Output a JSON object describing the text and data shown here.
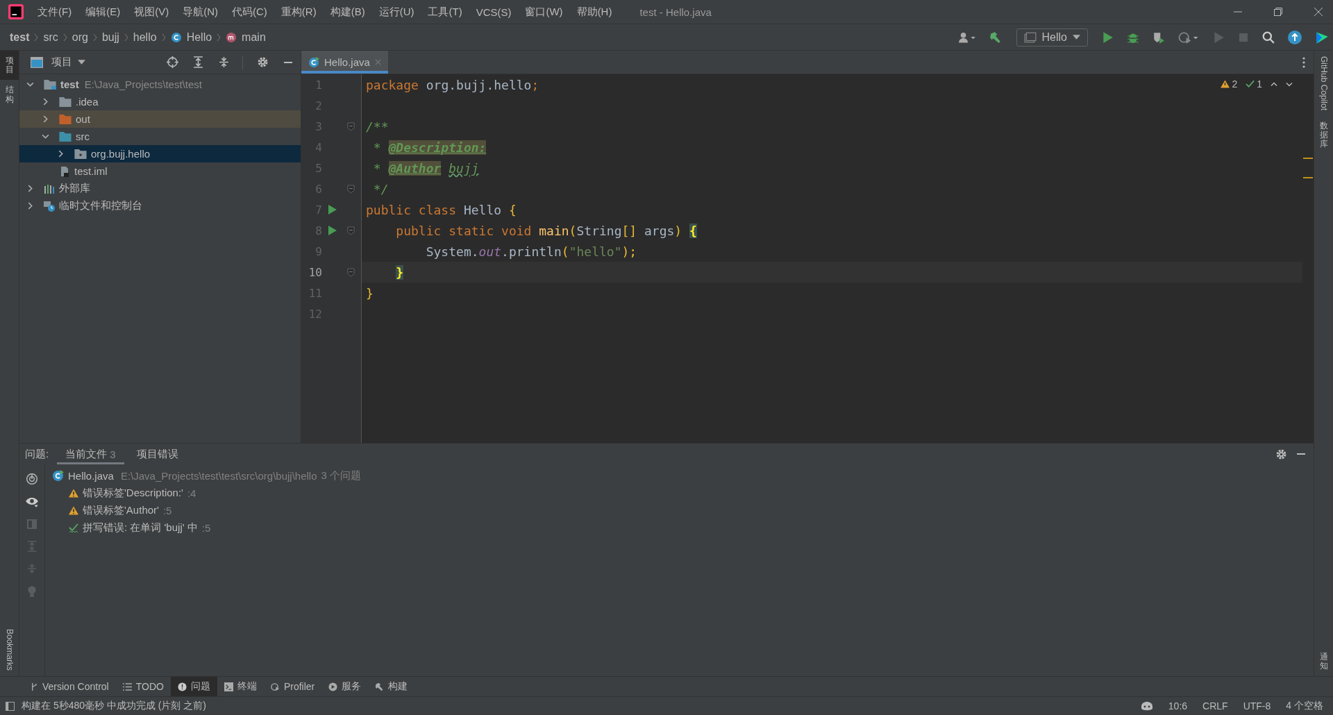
{
  "window": {
    "title": "test - Hello.java"
  },
  "menu": [
    "文件(F)",
    "编辑(E)",
    "视图(V)",
    "导航(N)",
    "代码(C)",
    "重构(R)",
    "构建(B)",
    "运行(U)",
    "工具(T)",
    "VCS(S)",
    "窗口(W)",
    "帮助(H)"
  ],
  "breadcrumbs": [
    {
      "label": "test",
      "kind": "project"
    },
    {
      "label": "src",
      "kind": "dir"
    },
    {
      "label": "org",
      "kind": "dir"
    },
    {
      "label": "bujj",
      "kind": "dir"
    },
    {
      "label": "hello",
      "kind": "dir"
    },
    {
      "label": "Hello",
      "kind": "class"
    },
    {
      "label": "main",
      "kind": "method"
    }
  ],
  "run_config": "Hello",
  "left_strip": [
    {
      "label": "项目",
      "selected": true
    },
    {
      "label": "结构",
      "selected": false
    }
  ],
  "left_strip_bottom": "Bookmarks",
  "right_strip": [
    {
      "label": "GitHub Copilot",
      "kind": "latin"
    },
    {
      "label": "数据库",
      "kind": "cjk"
    }
  ],
  "right_strip_bottom": "通知",
  "project": {
    "title": "项目",
    "tree": [
      {
        "label": "test",
        "path": "E:\\Java_Projects\\test\\test",
        "kind": "module",
        "expanded": true,
        "selected": false,
        "children": [
          {
            "label": ".idea",
            "kind": "folder",
            "expanded": false,
            "selected": false
          },
          {
            "label": "out",
            "kind": "excluded",
            "expanded": false,
            "selected": false
          },
          {
            "label": "src",
            "kind": "source",
            "expanded": true,
            "selected": false,
            "children": [
              {
                "label": "org.bujj.hello",
                "kind": "package",
                "expanded": false,
                "selected": true
              }
            ]
          },
          {
            "label": "test.iml",
            "kind": "file",
            "selected": false
          }
        ]
      },
      {
        "label": "外部库",
        "kind": "library",
        "expanded": false,
        "selected": false
      },
      {
        "label": "临时文件和控制台",
        "kind": "scratch",
        "expanded": false,
        "selected": false
      }
    ]
  },
  "editor": {
    "tabs": [
      {
        "label": "Hello.java",
        "selected": true
      }
    ],
    "warnings": "2",
    "typos": "1",
    "lines": [
      {
        "n": "1",
        "current": false,
        "tokens": [
          {
            "t": "package ",
            "kind": "kw"
          },
          {
            "t": "org.bujj.hello",
            "kind": "plain"
          },
          {
            "t": ";",
            "kind": "kw"
          }
        ]
      },
      {
        "n": "2",
        "current": false
      },
      {
        "n": "3",
        "current": false,
        "fold": true,
        "tokens": [
          {
            "t": "/**",
            "kind": "doc"
          }
        ]
      },
      {
        "n": "4",
        "current": false,
        "tokens": [
          {
            "t": " * ",
            "kind": "doc"
          },
          {
            "t": "@Description:",
            "kind": "tag"
          }
        ]
      },
      {
        "n": "5",
        "current": false,
        "tokens": [
          {
            "t": " * ",
            "kind": "doc"
          },
          {
            "t": "@Author",
            "kind": "tag"
          },
          {
            "t": "bujj",
            "kind": "typo"
          }
        ]
      },
      {
        "n": "6",
        "current": false,
        "fold": true,
        "tokens": [
          {
            "t": " */",
            "kind": "doc"
          }
        ]
      },
      {
        "n": "7",
        "current": false,
        "run": true,
        "tokens": [
          {
            "t": "public class ",
            "kind": "kw"
          },
          {
            "t": "Hello ",
            "kind": "plain"
          },
          {
            "t": "{",
            "kind": "brace"
          }
        ]
      },
      {
        "n": "8",
        "current": false,
        "run": true,
        "fold": true,
        "tokens": [
          {
            "t": "    public static void ",
            "kind": "kw"
          },
          {
            "t": "main",
            "kind": "method"
          },
          {
            "t": "(",
            "kind": "brace"
          },
          {
            "t": "String",
            "kind": "plain"
          },
          {
            "t": "[] ",
            "kind": "brace"
          },
          {
            "t": "args",
            "kind": "plain"
          },
          {
            "t": ") ",
            "kind": "brace"
          },
          {
            "t": "{",
            "kind": "match"
          }
        ]
      },
      {
        "n": "9",
        "current": false,
        "tokens": [
          {
            "t": "        System.",
            "kind": "plain"
          },
          {
            "t": "out",
            "kind": "field"
          },
          {
            "t": ".println",
            "kind": "plain"
          },
          {
            "t": "(",
            "kind": "brace"
          },
          {
            "t": "\"hello\"",
            "kind": "str"
          },
          {
            "t": ");",
            "kind": "brace"
          }
        ]
      },
      {
        "n": "10",
        "current": true,
        "fold": true,
        "tokens": [
          {
            "t": "    }",
            "kind": "match"
          }
        ]
      },
      {
        "n": "11",
        "current": false,
        "tokens": [
          {
            "t": "}",
            "kind": "brace"
          }
        ]
      },
      {
        "n": "12",
        "current": false
      }
    ]
  },
  "problems": {
    "label": "问题:",
    "tabs": [
      {
        "label": "当前文件",
        "count": "3",
        "selected": true
      },
      {
        "label": "项目错误",
        "selected": false
      }
    ],
    "file": {
      "name": "Hello.java",
      "path": "E:\\Java_Projects\\test\\test\\src\\org\\bujj\\hello",
      "summary": "3 个问题"
    },
    "items": [
      {
        "kind": "warning",
        "text": "错误标签'Description:'",
        "line": ":4"
      },
      {
        "kind": "warning",
        "text": "错误标签'Author'",
        "line": ":5"
      },
      {
        "kind": "typo",
        "text": "拼写错误: 在单词 'bujj' 中",
        "line": ":5"
      }
    ]
  },
  "tool_tabs": [
    {
      "label": "Version Control",
      "kind": "vcs",
      "selected": false
    },
    {
      "label": "TODO",
      "kind": "todo",
      "selected": false
    },
    {
      "label": "问题",
      "kind": "problems",
      "selected": true
    },
    {
      "label": "终端",
      "kind": "terminal",
      "selected": false
    },
    {
      "label": "Profiler",
      "kind": "profiler",
      "selected": false
    },
    {
      "label": "服务",
      "kind": "services",
      "selected": false
    },
    {
      "label": "构建",
      "kind": "build",
      "selected": false
    }
  ],
  "status_bar": {
    "message": "构建在 5秒480毫秒 中成功完成 (片刻 之前)",
    "position": "10:6",
    "line_ending": "CRLF",
    "encoding": "UTF-8",
    "indent": "4 个空格"
  }
}
